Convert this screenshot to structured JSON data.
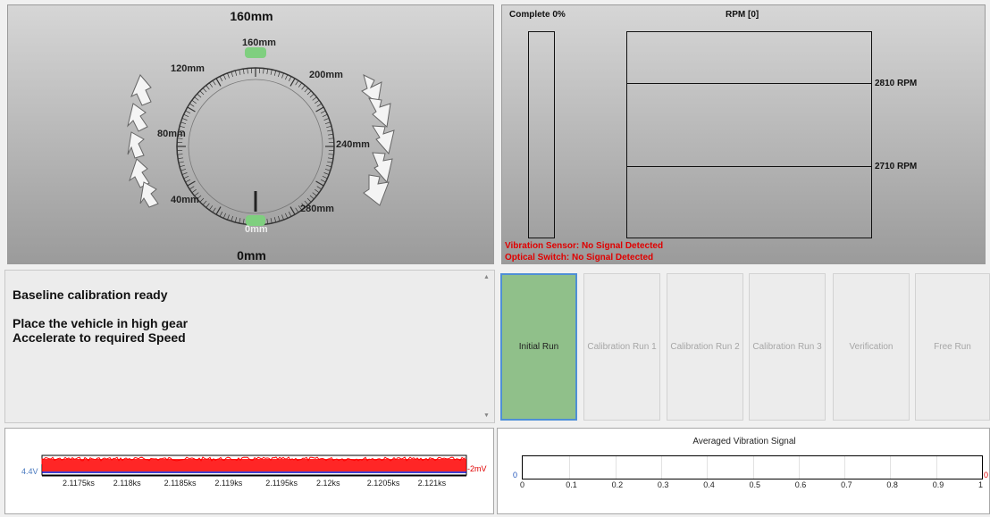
{
  "dial": {
    "top_reading": "160mm",
    "bottom_reading": "0mm",
    "labels": {
      "l160": "160mm",
      "l120": "120mm",
      "l200": "200mm",
      "l80": "80mm",
      "l240": "240mm",
      "l40": "40mm",
      "l280": "280mm",
      "l0": "0mm"
    }
  },
  "rpm": {
    "complete_label": "Complete 0%",
    "rpm_title": "RPM [0]",
    "upper_threshold": "2810 RPM",
    "lower_threshold": "2710 RPM",
    "vibration_status": "Vibration Sensor: No Signal Detected",
    "optical_status": "Optical Switch: No Signal Detected",
    "complete_percent": 0
  },
  "messages": {
    "line1": "Baseline calibration ready",
    "line2": "Place the vehicle in high gear",
    "line3": "Accelerate to required Speed"
  },
  "buttons": [
    {
      "label": "Initial Run",
      "active": true
    },
    {
      "label": "Calibration Run 1",
      "active": false
    },
    {
      "label": "Calibration Run 2",
      "active": false
    },
    {
      "label": "Calibration Run 3",
      "active": false
    },
    {
      "label": "Verification",
      "active": false
    },
    {
      "label": "Free Run",
      "active": false
    }
  ],
  "waveform": {
    "left_value": "4.4V",
    "right_value": "-2mV",
    "ticks": [
      "2.1175ks",
      "2.118ks",
      "2.1185ks",
      "2.119ks",
      "2.1195ks",
      "2.12ks",
      "2.1205ks",
      "2.121ks"
    ]
  },
  "averaged": {
    "title": "Averaged Vibration Signal",
    "left_value": "0",
    "right_value": "0",
    "ticks": [
      "0",
      "0.1",
      "0.2",
      "0.3",
      "0.4",
      "0.5",
      "0.6",
      "0.7",
      "0.8",
      "0.9",
      "1"
    ]
  },
  "colors": {
    "button_active": "#90c08a",
    "status_red": "#e00000",
    "signal_red": "#ff0000",
    "baseline_blue": "#0000c0"
  }
}
